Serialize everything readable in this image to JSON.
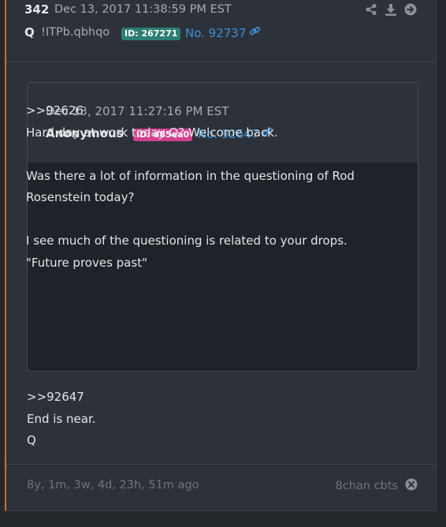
{
  "post": {
    "number": "342",
    "date": "Dec 13, 2017 11:38:59 PM EST",
    "author": "Q",
    "tripcode": "!ITPb.qbhqo",
    "id_badge": "ID: 267271",
    "post_link": "No. 92737",
    "body": ">>92647\nEnd is near.\nQ"
  },
  "quoted_post": {
    "date": "Dec 13, 2017 11:27:16 PM EST",
    "author": "Anonymous",
    "id_badge": "ID: d85ea0",
    "post_link": "No. 92647",
    "body": ">>92626\nHard day at work today Q? Welcome back.\n\nWas there a lot of information in the questioning of Rod\nRosenstein today?\n\nI see much of the questioning is related to your drops.\n\"Future proves past\""
  },
  "footer": {
    "age": "8y, 1m, 3w, 4d, 23h, 51m ago",
    "board": "8chan cbts"
  },
  "icons": {
    "header": [
      "share-icon",
      "download-icon",
      "arrow-right-circle-icon"
    ],
    "link": "link-icon",
    "footer": "close-circle-icon"
  },
  "colors": {
    "accent_border": "#c8751f",
    "id_green": "#2e7f73",
    "id_pink": "#d1418f",
    "link": "#3a8fd8"
  }
}
